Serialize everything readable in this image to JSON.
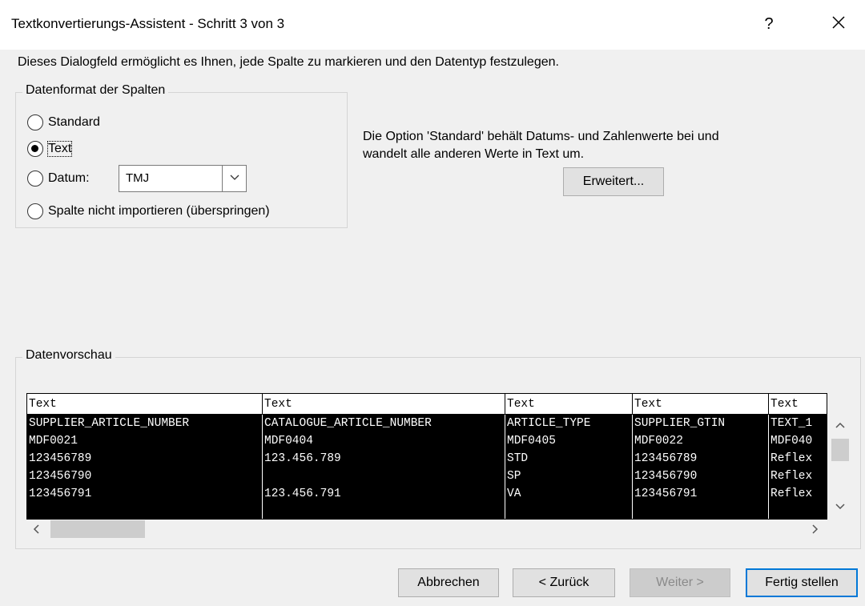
{
  "window": {
    "title": "Textkonvertierungs-Assistent - Schritt 3 von 3",
    "help_label": "?"
  },
  "description": "Dieses Dialogfeld ermöglicht es Ihnen, jede Spalte zu markieren und den Datentyp festzulegen.",
  "format_group": {
    "title": "Datenformat der Spalten",
    "options": [
      {
        "label": "Standard",
        "checked": false
      },
      {
        "label": "Text",
        "checked": true
      },
      {
        "label": "Datum:",
        "checked": false
      },
      {
        "label": "Spalte nicht importieren (überspringen)",
        "checked": false
      }
    ],
    "date_format_value": "TMJ"
  },
  "hint": {
    "line1": "Die Option 'Standard' behält Datums- und Zahlenwerte bei und",
    "line2": "wandelt alle anderen Werte in Text um."
  },
  "advanced_button": "Erweitert...",
  "preview": {
    "title": "Datenvorschau",
    "column_types": [
      "Text",
      "Text",
      "Text",
      "Text",
      "Text"
    ],
    "rows": [
      [
        "SUPPLIER_ARTICLE_NUMBER",
        "CATALOGUE_ARTICLE_NUMBER",
        "ARTICLE_TYPE",
        "SUPPLIER_GTIN",
        "TEXT_1"
      ],
      [
        "MDF0021",
        "MDF0404",
        "MDF0405",
        "MDF0022",
        "MDF040"
      ],
      [
        "123456789",
        "123.456.789",
        "STD",
        "123456789",
        "Reflex"
      ],
      [
        "123456790",
        "",
        "SP",
        "123456790",
        "Reflex"
      ],
      [
        "123456791",
        "123.456.791",
        "VA",
        "123456791",
        "Reflex"
      ]
    ]
  },
  "buttons": {
    "cancel": "Abbrechen",
    "back": "< Zurück",
    "next": "Weiter >",
    "finish": "Fertig stellen"
  },
  "colors": {
    "dialog_bg": "#f0f0f0",
    "selection_bg": "#000000",
    "default_button_border": "#0078d7"
  },
  "icons": {
    "close": "close-icon",
    "combo": "chevron-down-icon",
    "scroll_up": "chevron-up-icon",
    "scroll_down": "chevron-down-icon",
    "scroll_left": "chevron-left-icon",
    "scroll_right": "chevron-right-icon"
  }
}
